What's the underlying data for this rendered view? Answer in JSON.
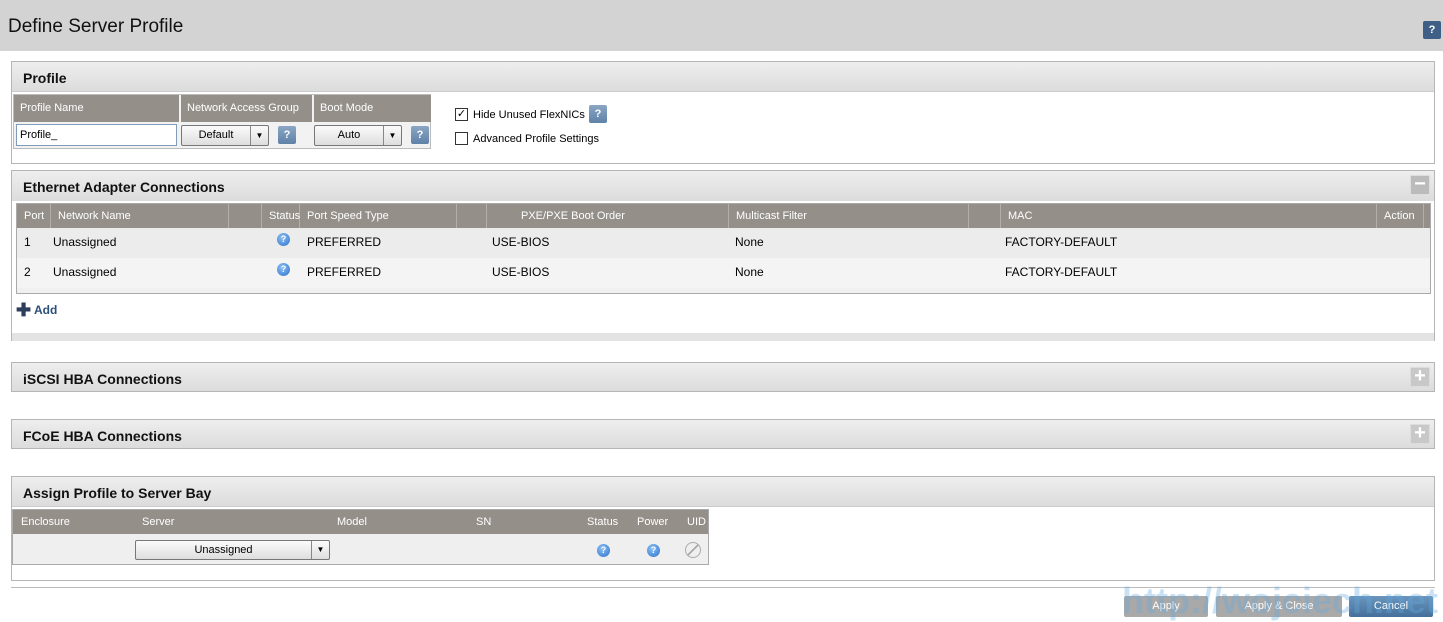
{
  "header": {
    "title": "Define Server Profile",
    "help_label": "?"
  },
  "profile": {
    "title": "Profile",
    "columns": [
      "Profile Name",
      "Network Access Group",
      "Boot Mode"
    ],
    "profile_name_value": "Profile_",
    "network_access_group": "Default",
    "boot_mode": "Auto",
    "hide_unused_flexnics": {
      "label": "Hide Unused FlexNICs",
      "checked": true
    },
    "advanced_profile_settings": {
      "label": "Advanced Profile Settings",
      "checked": false
    }
  },
  "ethernet": {
    "title": "Ethernet Adapter Connections",
    "collapse_label": "−",
    "columns": [
      "Port",
      "Network Name",
      "",
      "Status",
      "Port Speed Type",
      "",
      "PXE/PXE Boot Order",
      "Multicast Filter",
      "",
      "MAC",
      "Action"
    ],
    "rows": [
      {
        "port": "1",
        "network": "Unassigned",
        "status": "?",
        "speed": "PREFERRED",
        "pxe": "USE-BIOS",
        "multicast": "None",
        "mac": "FACTORY-DEFAULT"
      },
      {
        "port": "2",
        "network": "Unassigned",
        "status": "?",
        "speed": "PREFERRED",
        "pxe": "USE-BIOS",
        "multicast": "None",
        "mac": "FACTORY-DEFAULT"
      }
    ],
    "add_label": "Add"
  },
  "iscsi": {
    "title": "iSCSI HBA Connections",
    "expand_label": "+"
  },
  "fcoe": {
    "title": "FCoE HBA Connections",
    "expand_label": "+"
  },
  "assign": {
    "title": "Assign Profile to Server Bay",
    "columns": [
      "Enclosure",
      "Server",
      "Model",
      "SN",
      "Status",
      "Power",
      "UID"
    ],
    "server": "Unassigned",
    "status": "?",
    "power": "?"
  },
  "footer": {
    "apply": "Apply",
    "apply_close": "Apply & Close",
    "cancel": "Cancel"
  },
  "watermark": "http://wojciech.net",
  "colors": {
    "table_header": "#958f8a",
    "cancel_button": "#4f7ca6",
    "disabled_button": "#a9a9a9"
  }
}
